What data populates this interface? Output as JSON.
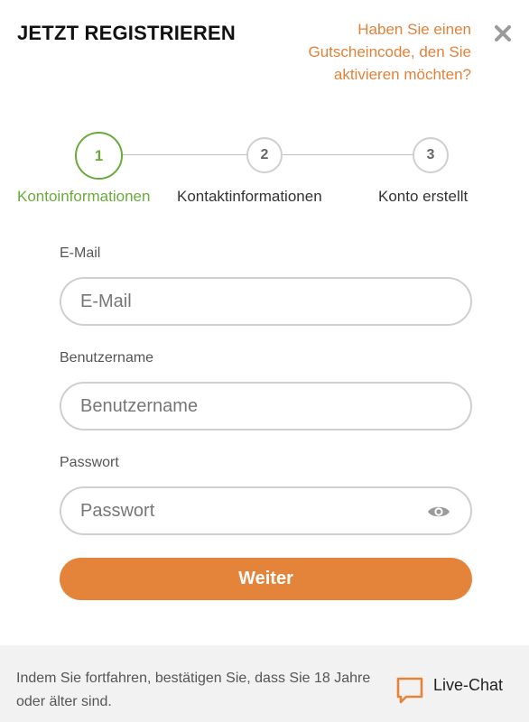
{
  "header": {
    "title": "JETZT REGISTRIEREN",
    "voucher_link": "Haben Sie einen Gutscheincode, den Sie aktivieren möchten?"
  },
  "stepper": {
    "steps": [
      {
        "number": "1",
        "label": "Kontoinformationen"
      },
      {
        "number": "2",
        "label": "Kontaktinformationen"
      },
      {
        "number": "3",
        "label": "Konto erstellt"
      }
    ],
    "active_color": "#6aaa3b"
  },
  "form": {
    "email": {
      "label": "E-Mail",
      "placeholder": "E-Mail",
      "value": ""
    },
    "username": {
      "label": "Benutzername",
      "placeholder": "Benutzername",
      "value": ""
    },
    "password": {
      "label": "Passwort",
      "placeholder": "Passwort",
      "value": ""
    },
    "submit_label": "Weiter"
  },
  "footer": {
    "notice": "Indem Sie fortfahren, bestätigen Sie, dass Sie 18 Jahre oder älter sind.",
    "livechat_label": "Live-Chat"
  },
  "colors": {
    "accent": "#e4843b",
    "link": "#e0823a",
    "step_active": "#6aaa3b"
  },
  "icons": [
    "close-icon",
    "eye-icon",
    "chat-bubble-icon"
  ]
}
